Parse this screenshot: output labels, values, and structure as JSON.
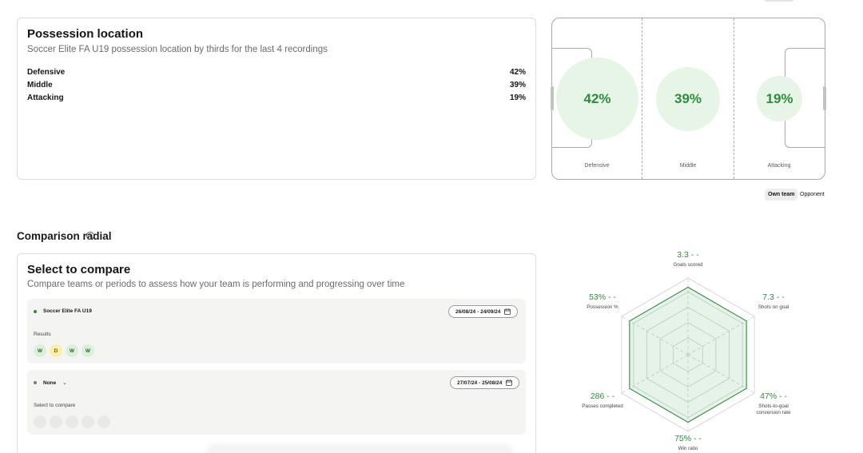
{
  "possession": {
    "title": "Possession location",
    "subtitle": "Soccer Elite FA U19 possession location by thirds for the last 4 recordings",
    "rows": [
      {
        "label": "Defensive",
        "value": "42%"
      },
      {
        "label": "Middle",
        "value": "39%"
      },
      {
        "label": "Attacking",
        "value": "19%"
      }
    ],
    "pitch": {
      "zones": [
        {
          "label": "Defensive",
          "value": "42%"
        },
        {
          "label": "Middle",
          "value": "39%"
        },
        {
          "label": "Attacking",
          "value": "19%"
        }
      ]
    },
    "toggle": {
      "own": "Own team",
      "opponent": "Opponent",
      "active": "own"
    }
  },
  "comparison": {
    "section_title": "Comparison radial",
    "card_title": "Select to compare",
    "card_subtitle": "Compare teams or periods to assess how your team is performing and progressing over time",
    "primary": {
      "team": "Soccer Elite FA U19",
      "dates": "26/08/24 - 24/09/24",
      "results_label": "Results",
      "results": [
        "W",
        "D",
        "W",
        "W"
      ],
      "dot_color": "#2e8b3e"
    },
    "secondary": {
      "team": "None",
      "dates": "27/07/24 - 25/08/24",
      "select_label": "Select to compare",
      "dot_color": "#777777"
    },
    "radial": {
      "accent": "#2e8b3e",
      "dash": "- -",
      "metrics": [
        {
          "value": "3.3",
          "label": "Goals scored",
          "fraction": 0.88
        },
        {
          "value": "7.3",
          "label": "Shots on goal",
          "fraction": 0.88
        },
        {
          "value": "47%",
          "label": "Shots-to-goal conversion rate",
          "fraction": 0.88
        },
        {
          "value": "75%",
          "label": "Win ratio",
          "fraction": 0.88
        },
        {
          "value": "286",
          "label": "Passes completed",
          "fraction": 0.88
        },
        {
          "value": "53%",
          "label": "Possession %",
          "fraction": 0.88
        }
      ]
    }
  }
}
